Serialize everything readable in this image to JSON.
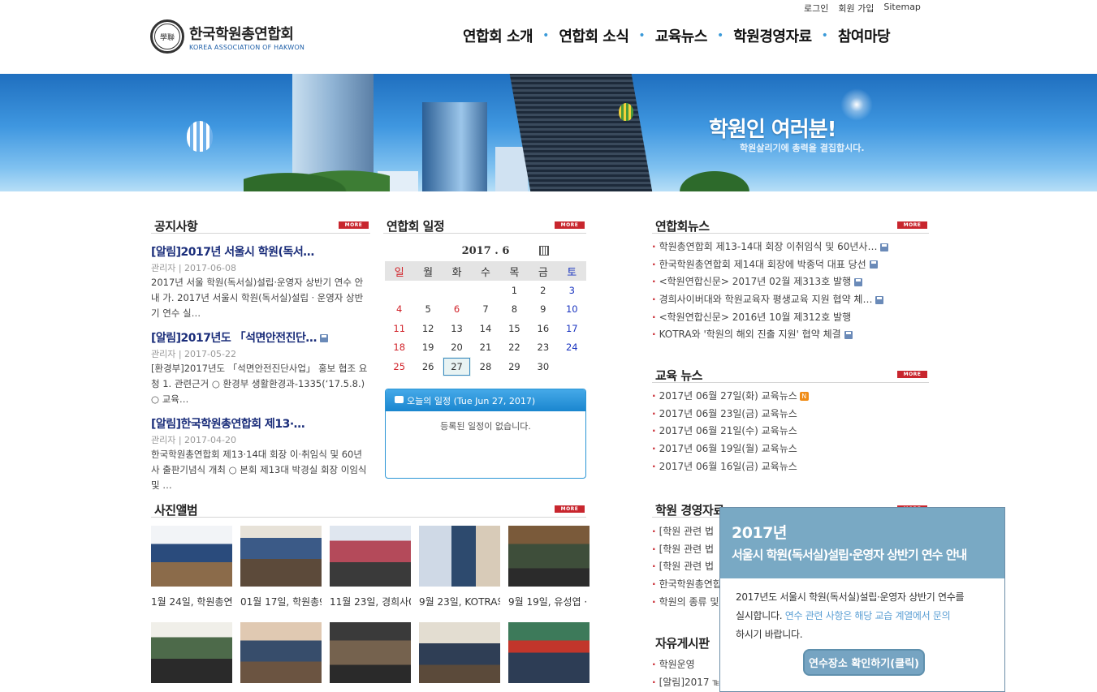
{
  "util": {
    "login": "로그인",
    "join": "회원 가입",
    "sitemap": "Sitemap"
  },
  "logo": {
    "ko": "한국학원총연합회",
    "en": "KOREA ASSOCIATION OF HAKWON",
    "seal": "學聯"
  },
  "gnb": [
    "연합회 소개",
    "연합회 소식",
    "교육뉴스",
    "학원경영자료",
    "참여마당"
  ],
  "banner": {
    "title": "학원인 여러분!",
    "subtitle": "학원살리기에 총력을 결집합시다."
  },
  "more_label": "MORE",
  "notice": {
    "title": "공지사항",
    "items": [
      {
        "title": "[알림]2017년 서울시 학원(독서…",
        "meta": "관리자 | 2017-06-08",
        "body": "2017년 서울 학원(독서실)설립·운영자 상반기 연수 안내 가. 2017년 서울시 학원(독서실)설립ㆍ운영자 상반기 연수 실…"
      },
      {
        "title": "[알림]2017년도 「석면안전진단…",
        "meta": "관리자 | 2017-05-22",
        "body": "[환경부]2017년도 「석면안전진단사업」 홍보 협조 요청 1. 관련근거 ○ 환경부 생활환경과-1335(‘17.5.8.) ○ 교육…"
      },
      {
        "title": "[알림]한국학원총연합회 제13·…",
        "meta": "관리자 | 2017-04-20",
        "body": "한국학원총연합회 제13·14대 회장 이·취임식 및 60년사 출판기념식 개최 ○ 본회 제13대 박경실 회장 이임식 및 …"
      }
    ]
  },
  "schedule": {
    "title": "연합회 일정",
    "month": "2017 . 6",
    "weekdays": [
      "일",
      "월",
      "화",
      "수",
      "목",
      "금",
      "토"
    ],
    "weeks": [
      [
        "",
        "",
        "",
        "",
        "1",
        "2",
        "3"
      ],
      [
        "4",
        "5",
        "6",
        "7",
        "8",
        "9",
        "10"
      ],
      [
        "11",
        "12",
        "13",
        "14",
        "15",
        "16",
        "17"
      ],
      [
        "18",
        "19",
        "20",
        "21",
        "22",
        "23",
        "24"
      ],
      [
        "25",
        "26",
        "27",
        "28",
        "29",
        "30",
        ""
      ]
    ],
    "today": "27",
    "red_days": [
      "6"
    ],
    "today_title": "오늘의 일정 (Tue Jun 27, 2017)",
    "today_empty": "등록된 일정이 없습니다."
  },
  "news": {
    "title": "연합회뉴스",
    "items": [
      {
        "text": "학원총연합회 제13-14대 회장 이취임식 및 60년사…",
        "disk": true
      },
      {
        "text": "한국학원총연합회 제14대 회장에 박종덕 대표 당선",
        "disk": true
      },
      {
        "text": "<학원연합신문> 2017년 02월 제313호 발행",
        "disk": true
      },
      {
        "text": "경희사이버대와 학원교육자 평생교육 지원 협약 체…",
        "disk": true
      },
      {
        "text": "<학원연합신문> 2016년 10월 제312호 발행",
        "disk": false
      },
      {
        "text": "KOTRA와 '학원의 해외 진출 지원' 협약 체결",
        "disk": true
      }
    ]
  },
  "edu_news": {
    "title": "교육 뉴스",
    "items": [
      "2017년 06월 27일(화) 교육뉴스",
      "2017년 06월 23일(금) 교육뉴스",
      "2017년 06월 21일(수) 교육뉴스",
      "2017년 06월 19일(월) 교육뉴스",
      "2017년 06월 16일(금) 교육뉴스"
    ],
    "new_badge": "N"
  },
  "mgmt": {
    "title": "학원 경영자료",
    "items": [
      "[학원 관련 법",
      "[학원 관련 법",
      "[학원 관련 법",
      "한국학원총연합",
      "학원의 종류 및"
    ]
  },
  "board": {
    "title": "자유게시판",
    "items": [
      "학원운영",
      "[알림]2017 ℡"
    ]
  },
  "album": {
    "title": "사진앨범",
    "captions": [
      "1월 24일, 학원총연",
      "01월 17일, 학원총9",
      "11월 23일, 경희사0",
      "9월 23일, KOTRA와",
      "9월 19일, 유성엽 ·"
    ]
  },
  "popup": {
    "year": "2017년",
    "subtitle": "서울시 학원(독서실)설립·운영자 상반기 연수 안내",
    "line1": "2017년도 서울시 학원(독서실)설립·운영자 상반기 연수를",
    "line2a": "실시합니다. ",
    "line2b": "연수 관련 사항은 해당 교습 계열에서 문의",
    "line3": "하시기 바랍니다.",
    "button": "연수장소 확인하기(클릭)"
  }
}
